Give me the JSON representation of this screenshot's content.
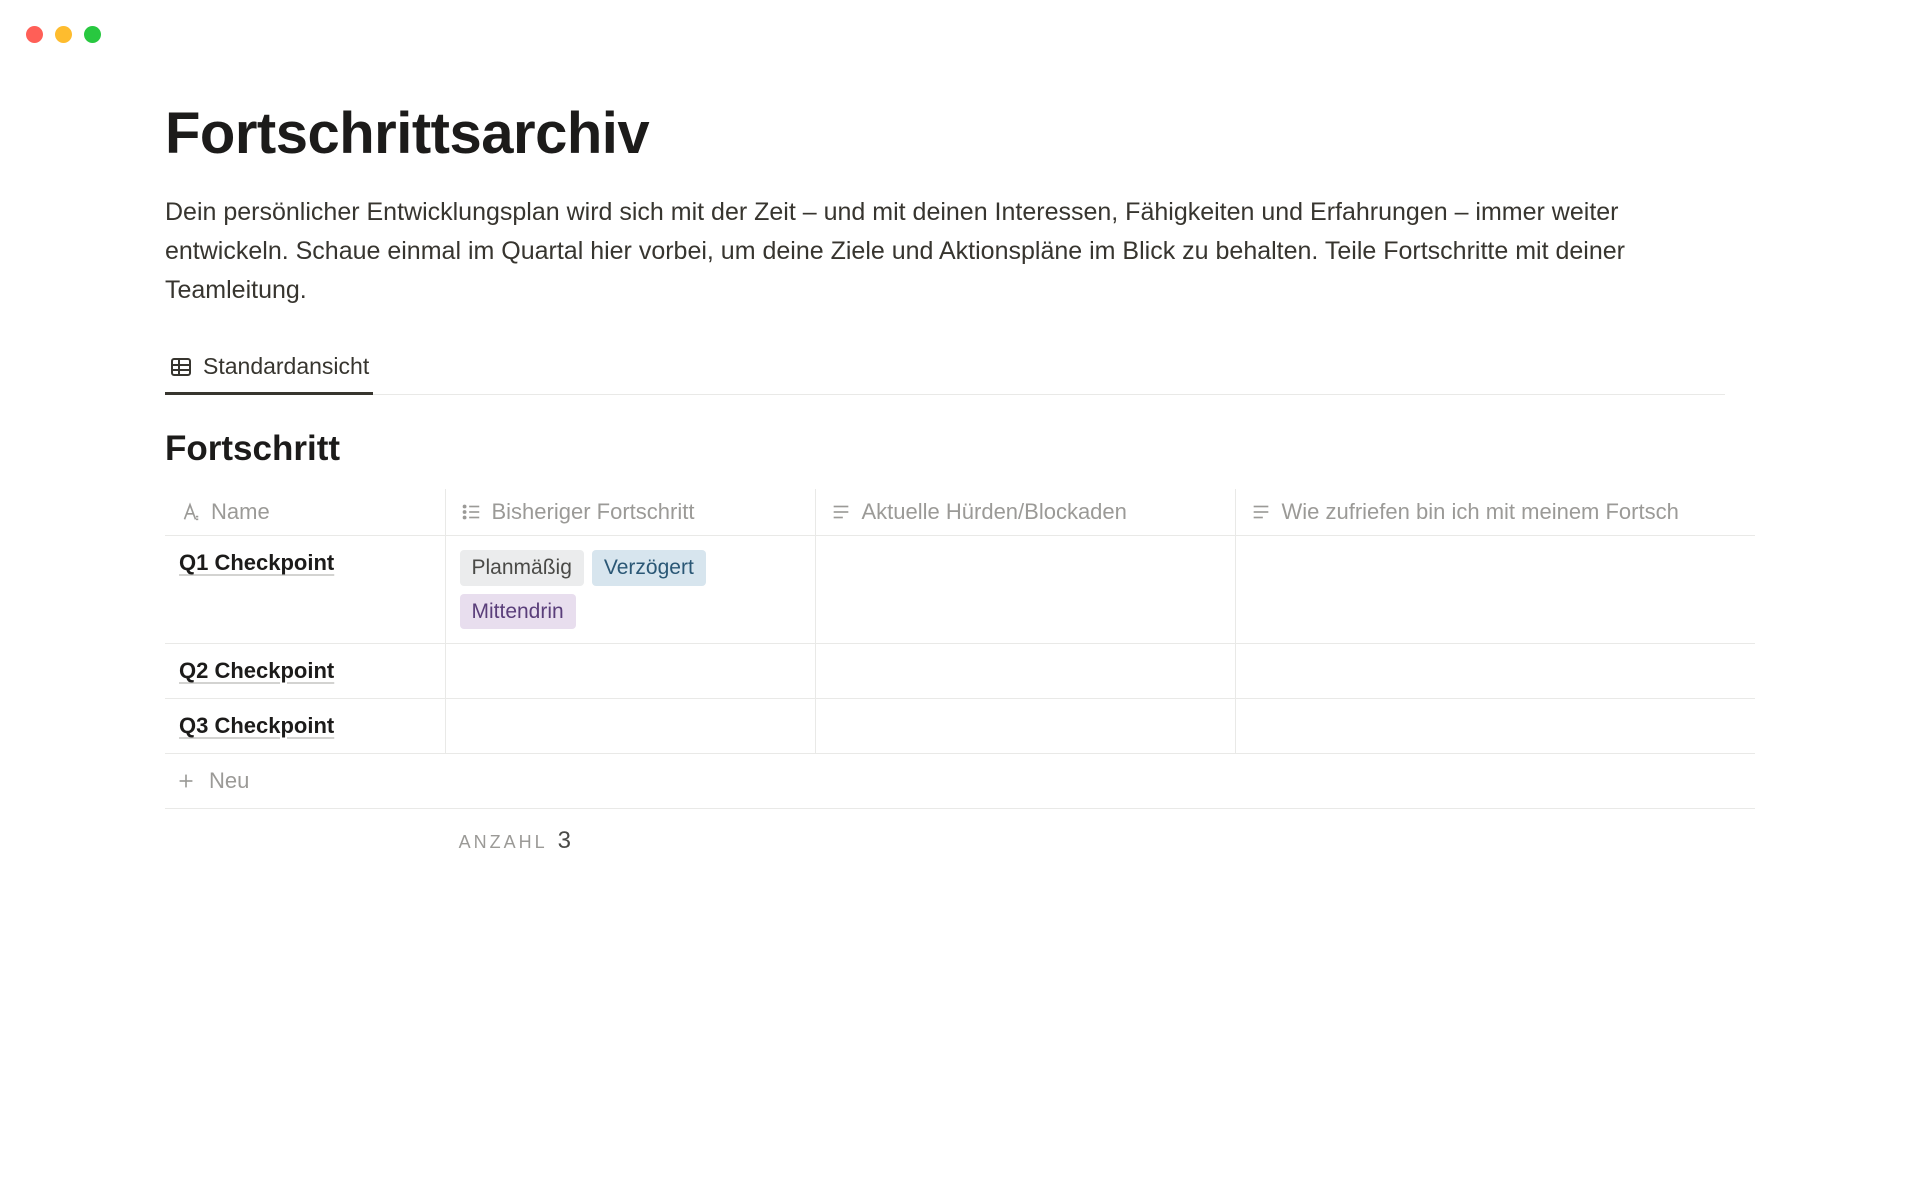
{
  "page": {
    "title": "Fortschrittsarchiv",
    "description": "Dein persönlicher Entwicklungsplan wird sich mit der Zeit – und mit deinen Interessen, Fähigkeiten und Erfahrungen – immer weiter entwickeln. Schaue einmal im Quartal hier vorbei, um deine Ziele und Aktionspläne im Blick zu behalten. Teile Fortschritte mit deiner Teamleitung."
  },
  "view": {
    "active": "Standardansicht"
  },
  "database": {
    "title": "Fortschritt",
    "columns": {
      "name": "Name",
      "progress": "Bisheriger Fortschritt",
      "blockers": "Aktuelle Hürden/Blockaden",
      "satisfaction": "Wie zufriefen bin ich mit meinem Fortsch"
    },
    "rows": [
      {
        "name": "Q1 Checkpoint",
        "tags": [
          "Planmäßig",
          "Verzögert",
          "Mittendrin"
        ]
      },
      {
        "name": "Q2 Checkpoint",
        "tags": []
      },
      {
        "name": "Q3 Checkpoint",
        "tags": []
      }
    ],
    "new_label": "Neu",
    "count_label": "ANZAHL",
    "count_value": "3"
  },
  "tag_colors": {
    "Planmäßig": "tag-gray",
    "Verzögert": "tag-blue",
    "Mittendrin": "tag-purple"
  }
}
